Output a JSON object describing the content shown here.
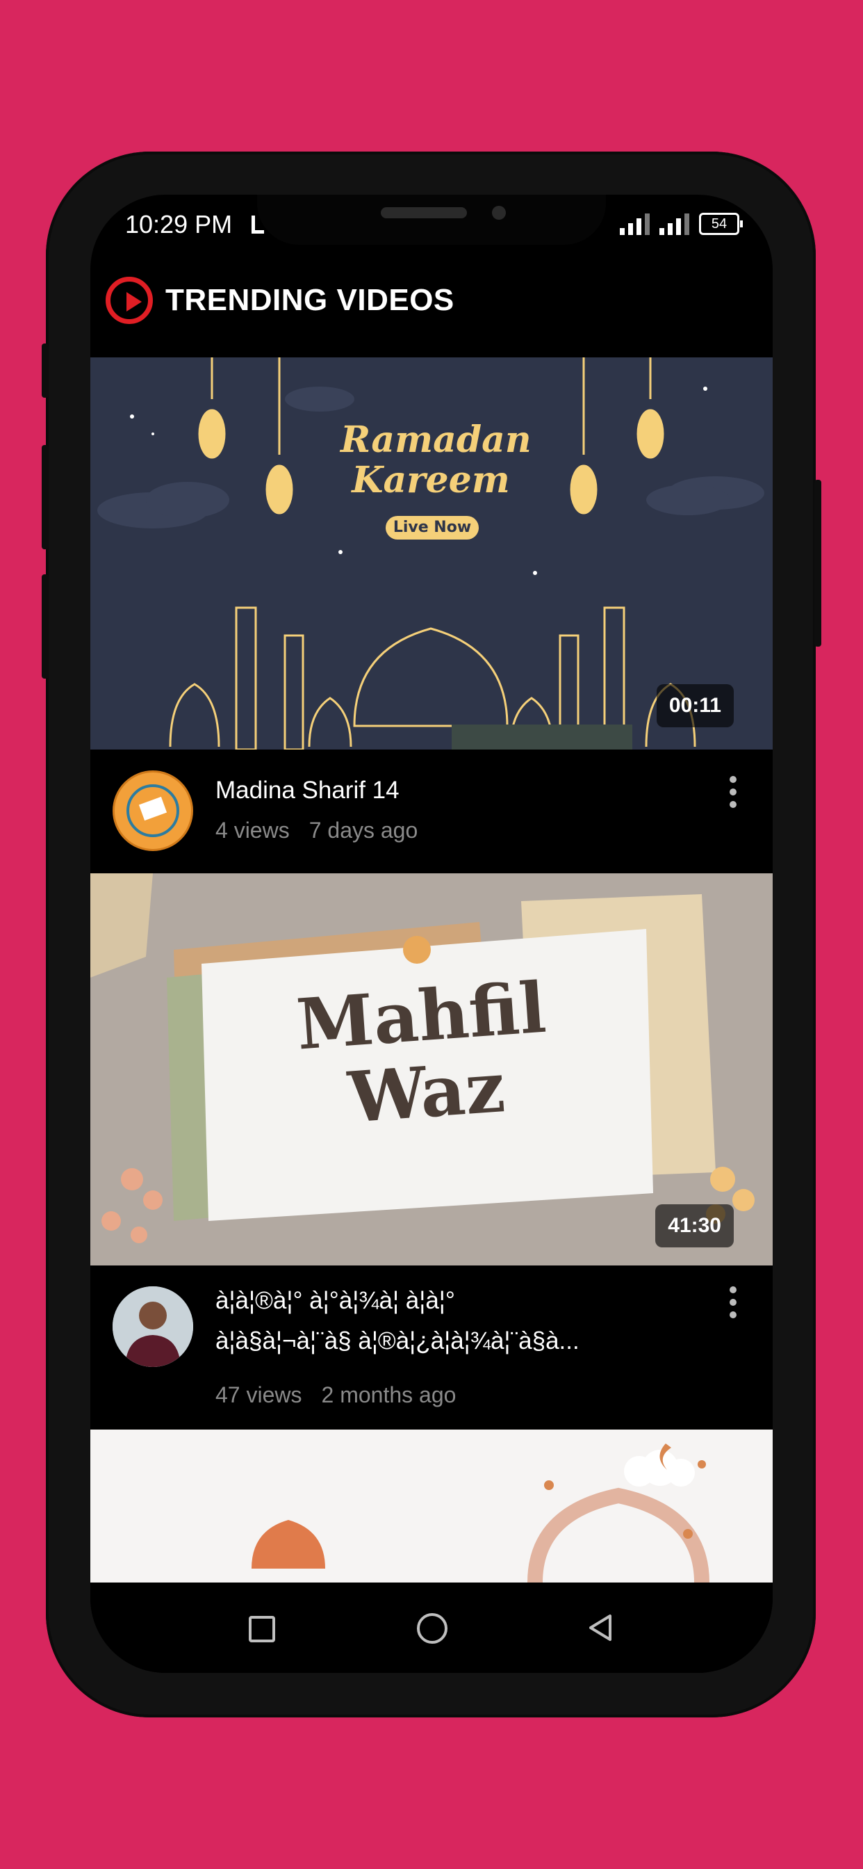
{
  "status_bar": {
    "time": "10:29 PM",
    "battery": "54"
  },
  "header": {
    "title": "TRENDING VIDEOS"
  },
  "videos": [
    {
      "thumbnail_title_line1": "Ramadan",
      "thumbnail_title_line2": "Kareem",
      "thumbnail_badge": "Live Now",
      "duration": "00:11",
      "title": "Madina Sharif 14",
      "views": "4 views",
      "age": "7 days ago"
    },
    {
      "thumbnail_title_line1": "Mahfil",
      "thumbnail_title_line2": "Waz",
      "duration": "41:30",
      "title_line1": "à¦à¦®à¦° à¦°à¦¾à¦ à¦à¦°",
      "title_line2": "à¦à§à¦¬à¦¨à§ à¦®à¦¿à¦à¦¾à¦¨à§à...",
      "views": "47 views",
      "age": "2 months ago"
    }
  ],
  "colors": {
    "background": "#d8265e",
    "accent": "#e01e24",
    "thumb1": "#2e3549",
    "gold": "#f5d079"
  }
}
